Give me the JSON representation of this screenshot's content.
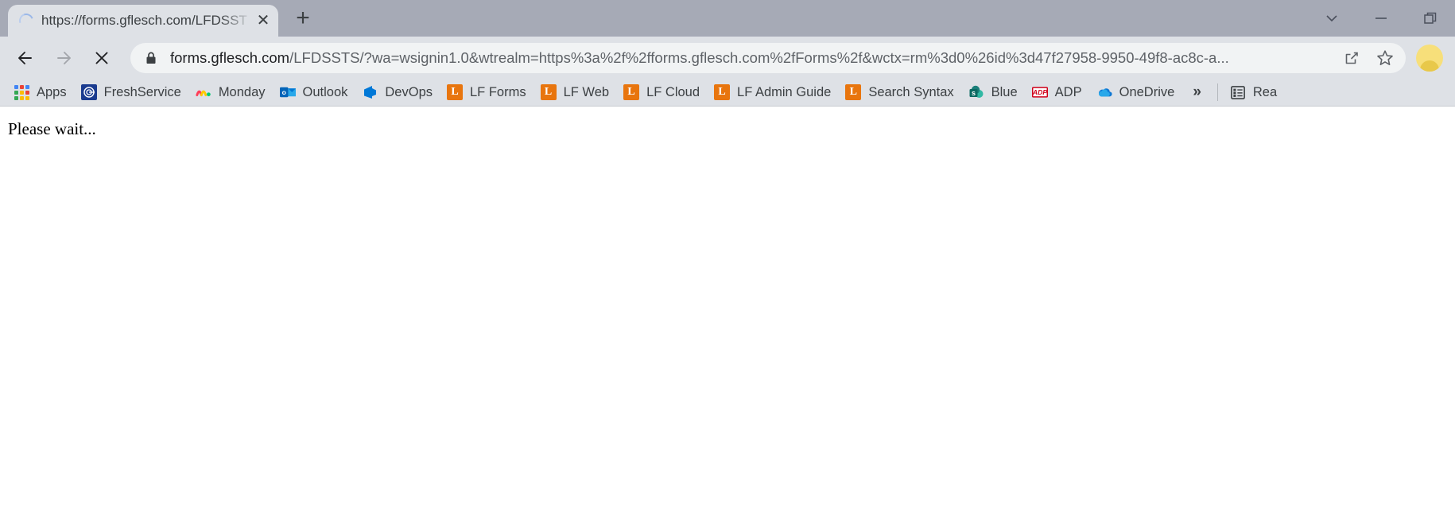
{
  "window": {
    "controls": [
      {
        "name": "tab-search",
        "glyph": "tab-search-chevron-icon"
      },
      {
        "name": "minimize",
        "glyph": "minimize-icon"
      },
      {
        "name": "restore",
        "glyph": "restore-icon"
      }
    ]
  },
  "tabstrip": {
    "tab": {
      "title": "https://forms.gflesch.com/LFDSST",
      "favicon": "loading-spinner-icon",
      "close_label": "✕"
    },
    "new_tab_label": "+"
  },
  "toolbar": {
    "back_label": "←",
    "forward_label": "→",
    "stop_label": "✕",
    "omnibox": {
      "lock_icon": "lock-icon",
      "host": "forms.gflesch.com",
      "path": "/LFDSSTS/?wa=wsignin1.0&wtrealm=https%3a%2f%2fforms.gflesch.com%2fForms%2f&wctx=rm%3d0%26id%3d47f27958-9950-49f8-ac8c-a..."
    },
    "share_icon": "share-icon",
    "bookmark_icon": "star-icon",
    "avatar": "profile-avatar"
  },
  "bookmarks": {
    "items": [
      {
        "label": "Apps",
        "icon": "apps-grid-icon"
      },
      {
        "label": "FreshService",
        "icon": "freshservice-icon"
      },
      {
        "label": "Monday",
        "icon": "monday-icon"
      },
      {
        "label": "Outlook",
        "icon": "outlook-icon"
      },
      {
        "label": "DevOps",
        "icon": "azure-devops-icon"
      },
      {
        "label": "LF Forms",
        "icon": "laserfiche-icon"
      },
      {
        "label": "LF Web",
        "icon": "laserfiche-icon"
      },
      {
        "label": "LF Cloud",
        "icon": "laserfiche-icon"
      },
      {
        "label": "LF Admin Guide",
        "icon": "laserfiche-icon"
      },
      {
        "label": "Search Syntax",
        "icon": "laserfiche-icon"
      },
      {
        "label": "Blue",
        "icon": "sharepoint-icon"
      },
      {
        "label": "ADP",
        "icon": "adp-icon"
      },
      {
        "label": "OneDrive",
        "icon": "onedrive-icon"
      }
    ],
    "overflow_label": "»",
    "reading_list": {
      "label": "Rea",
      "icon": "reading-list-icon"
    }
  },
  "page": {
    "body_text": "Please wait..."
  },
  "colors": {
    "titlebar": "#a6aab6",
    "toolbar": "#dee1e6",
    "tab_active": "#dee1e6",
    "omnibox": "#f1f3f4",
    "laserfiche_orange": "#e8750e",
    "accent_blue": "#1a73e8"
  }
}
